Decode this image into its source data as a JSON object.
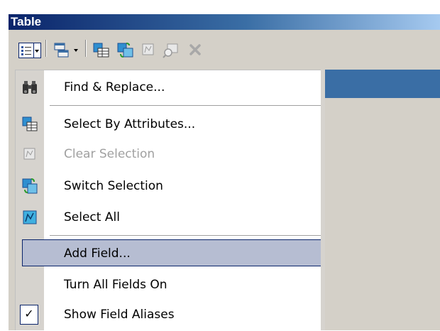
{
  "window": {
    "title": "Table"
  },
  "toolbar": {
    "buttons": [
      {
        "name": "table-options",
        "icon": "list-options-icon"
      },
      {
        "name": "related-tables",
        "icon": "related-tables-icon"
      },
      {
        "name": "select-by-attributes",
        "icon": "select-by-attributes-icon"
      },
      {
        "name": "switch-selection",
        "icon": "switch-selection-icon"
      },
      {
        "name": "clear-selection",
        "icon": "clear-selection-icon"
      },
      {
        "name": "zoom-to-selected",
        "icon": "zoom-to-selected-icon"
      },
      {
        "name": "delete-selected",
        "icon": "delete-icon"
      }
    ]
  },
  "menu": {
    "items": [
      {
        "label": "Find & Replace...",
        "icon": "binoculars-icon",
        "enabled": true
      },
      {
        "label": "Select By Attributes...",
        "icon": "select-by-attributes-icon",
        "enabled": true
      },
      {
        "label": "Clear Selection",
        "icon": "clear-selection-icon",
        "enabled": false
      },
      {
        "label": "Switch Selection",
        "icon": "switch-selection-icon",
        "enabled": true
      },
      {
        "label": "Select All",
        "icon": "select-all-icon",
        "enabled": true
      },
      {
        "label": "Add Field...",
        "icon": "",
        "enabled": true,
        "highlighted": true
      },
      {
        "label": "Turn All Fields On",
        "icon": "",
        "enabled": true
      },
      {
        "label": "Show Field Aliases",
        "icon": "checkmark-icon",
        "enabled": true,
        "checked": true
      }
    ]
  },
  "colors": {
    "titlebar_start": "#0a246a",
    "titlebar_end": "#a6caf0",
    "menu_highlight": "#b6bdd2",
    "disabled_text": "#a0a0a0"
  }
}
